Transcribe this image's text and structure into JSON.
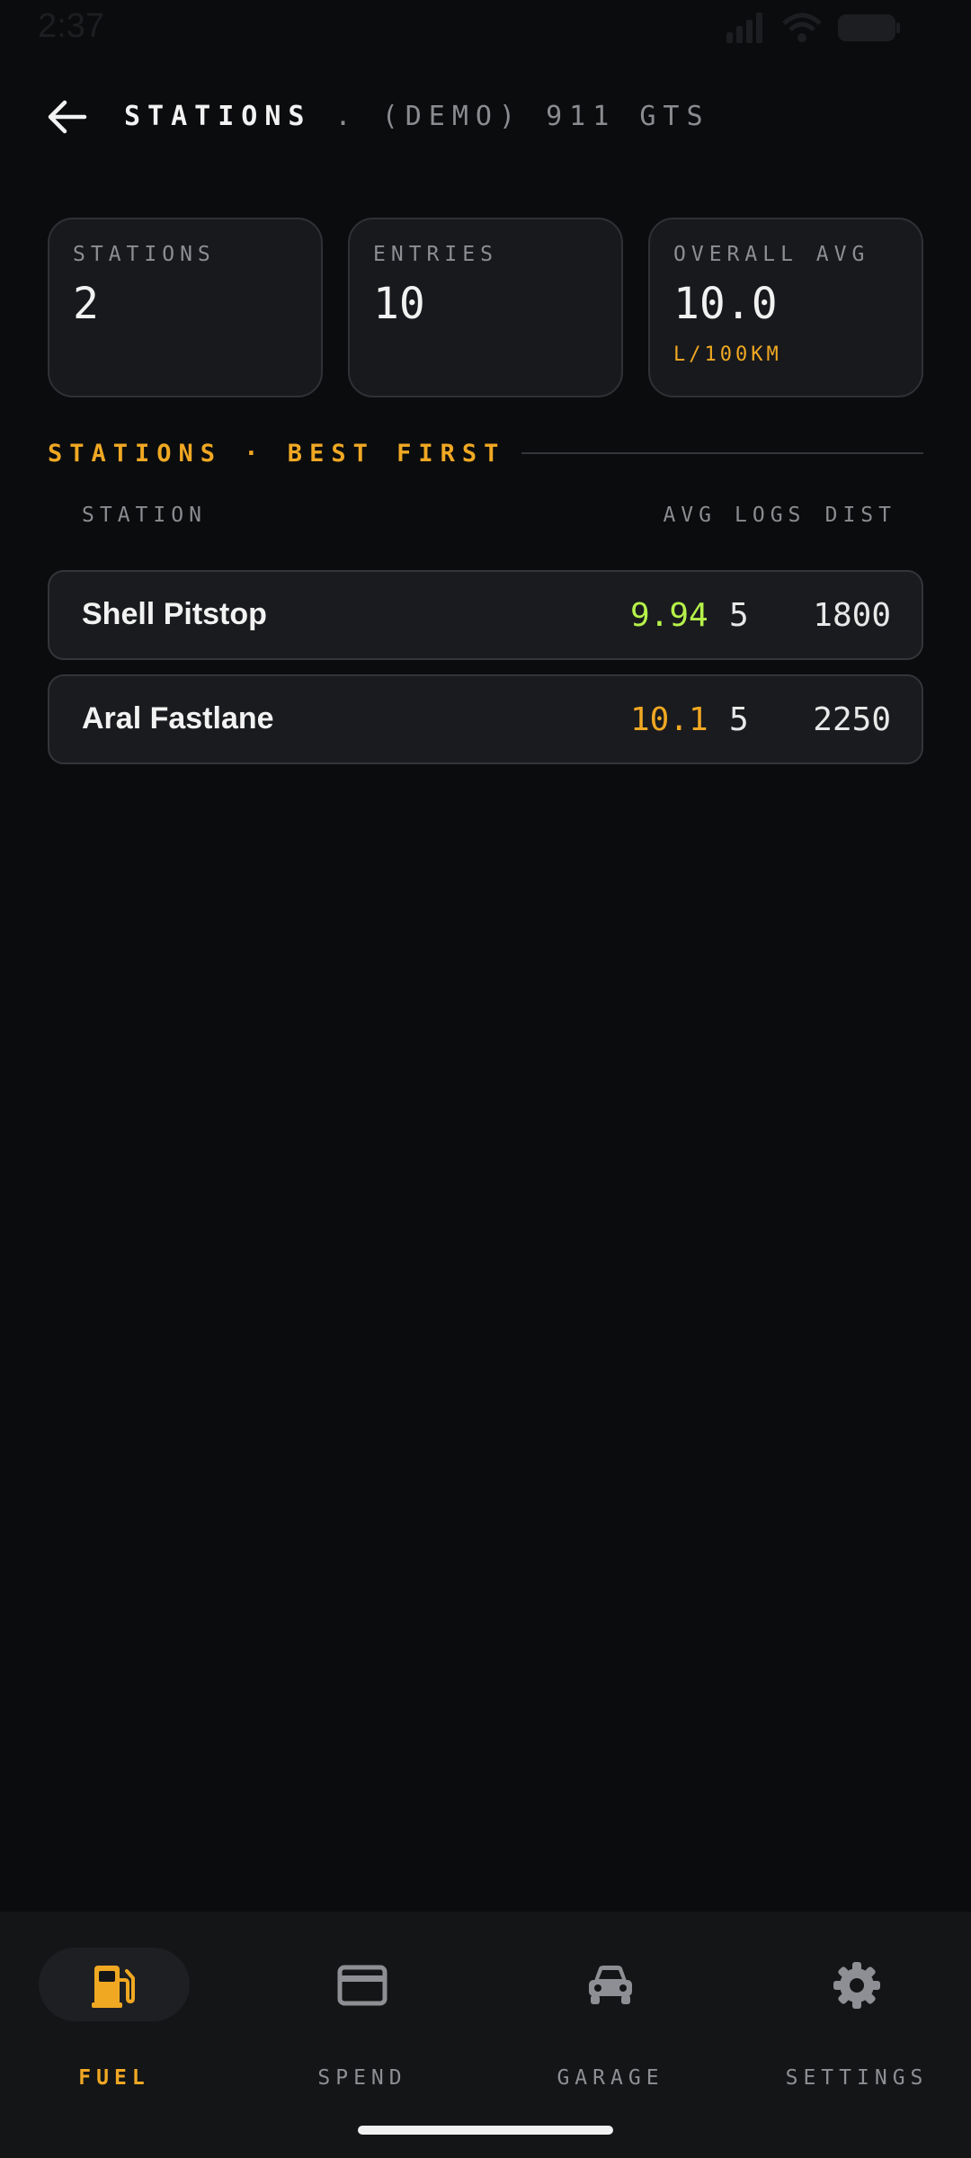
{
  "status_bar": {
    "time": "2:37"
  },
  "header": {
    "title_main": "STATIONS",
    "title_separator": " . ",
    "title_sub": "(DEMO) 911 GTS"
  },
  "stats": [
    {
      "label": "STATIONS",
      "value": "2",
      "unit": ""
    },
    {
      "label": "ENTRIES",
      "value": "10",
      "unit": ""
    },
    {
      "label": "OVERALL AVG",
      "value": "10.0",
      "unit": "L/100KM"
    }
  ],
  "section": {
    "title": "STATIONS · BEST FIRST"
  },
  "table": {
    "columns": {
      "station": "STATION",
      "avg": "AVG",
      "logs": "LOGS",
      "dist": "DIST"
    },
    "rows": [
      {
        "name": "Shell Pitstop",
        "avg": "9.94",
        "avg_color": "#b6f24a",
        "logs": "5",
        "dist": "1800"
      },
      {
        "name": "Aral Fastlane",
        "avg": "10.1",
        "avg_color": "#f0a823",
        "logs": "5",
        "dist": "2250"
      }
    ]
  },
  "nav": {
    "items": [
      {
        "label": "FUEL",
        "icon": "fuel-pump-icon",
        "active": true
      },
      {
        "label": "SPEND",
        "icon": "credit-card-icon",
        "active": false
      },
      {
        "label": "GARAGE",
        "icon": "car-icon",
        "active": false
      },
      {
        "label": "SETTINGS",
        "icon": "gear-icon",
        "active": false
      }
    ]
  },
  "colors": {
    "accent": "#f0a823",
    "good": "#b6f24a",
    "background": "#0b0c0e"
  }
}
